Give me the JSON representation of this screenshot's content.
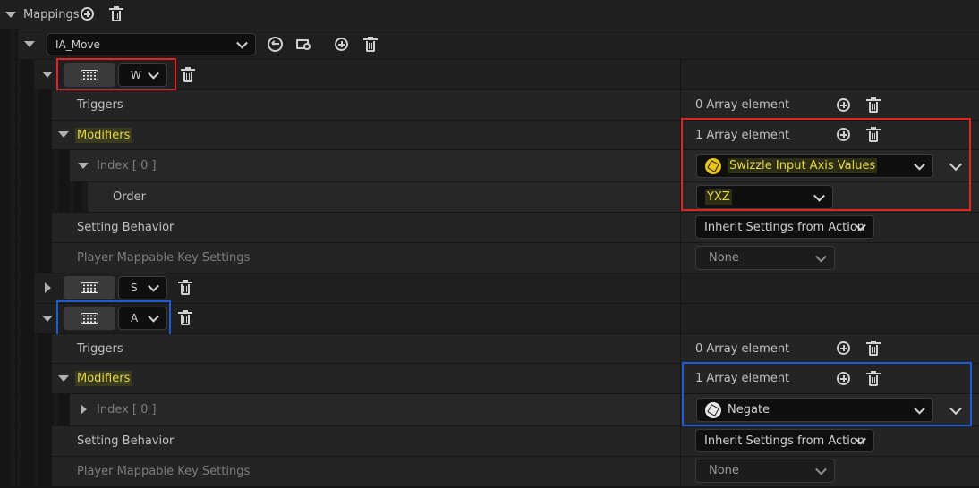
{
  "mappings": {
    "label": "Mappings"
  },
  "action": {
    "value": "IA_Move"
  },
  "key_w": {
    "key": "W",
    "triggers_label": "Triggers",
    "triggers_count": "0 Array element",
    "modifiers_label": "Modifiers",
    "modifiers_count": "1 Array element",
    "index_label": "Index [ 0 ]",
    "modifier_value": "Swizzle Input Axis Values",
    "order_label": "Order",
    "order_value": "YXZ",
    "setting_label": "Setting Behavior",
    "setting_value": "Inherit Settings from Action",
    "player_label": "Player Mappable Key Settings",
    "player_value": "None"
  },
  "key_s": {
    "key": "S"
  },
  "key_a": {
    "key": "A",
    "triggers_label": "Triggers",
    "triggers_count": "0 Array element",
    "modifiers_label": "Modifiers",
    "modifiers_count": "1 Array element",
    "index_label": "Index [ 0 ]",
    "modifier_value": "Negate",
    "setting_label": "Setting Behavior",
    "setting_value": "Inherit Settings from Action",
    "player_label": "Player Mappable Key Settings",
    "player_value": "None"
  },
  "colors": {
    "highlight_red": "#e02525",
    "highlight_blue": "#1f5ad8",
    "modifier_yellow": "#e8c51d"
  }
}
